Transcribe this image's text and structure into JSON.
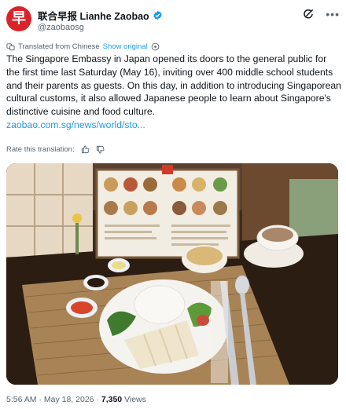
{
  "account": {
    "avatar_glyph": "早",
    "display_name": "联合早报 Lianhe Zaobao",
    "handle": "@zaobaosg",
    "verified_icon": "verified-badge-icon",
    "avatar_color": "#d9232a"
  },
  "translation": {
    "label": "Translated from Chinese",
    "show_original": "Show original",
    "rate_label": "Rate this translation:"
  },
  "tweet": {
    "text": "The Singapore Embassy in Japan opened its doors to the general public for the first time last Saturday (May 16), inviting over 400 middle school students and their parents as guests. On this day, in addition to introducing Singaporean cultural customs, it also allowed Japanese people to learn about Singapore's distinctive cuisine and food culture.",
    "link": "zaobao.com.sg/news/world/sto..."
  },
  "meta": {
    "time": "5:56 AM",
    "date": "May 18, 2026",
    "views": "7,350",
    "views_label": "Views",
    "separator": "·"
  },
  "colors": {
    "link": "#1d9bf0",
    "secondary_text": "#536471",
    "primary_text": "#0f1419"
  }
}
